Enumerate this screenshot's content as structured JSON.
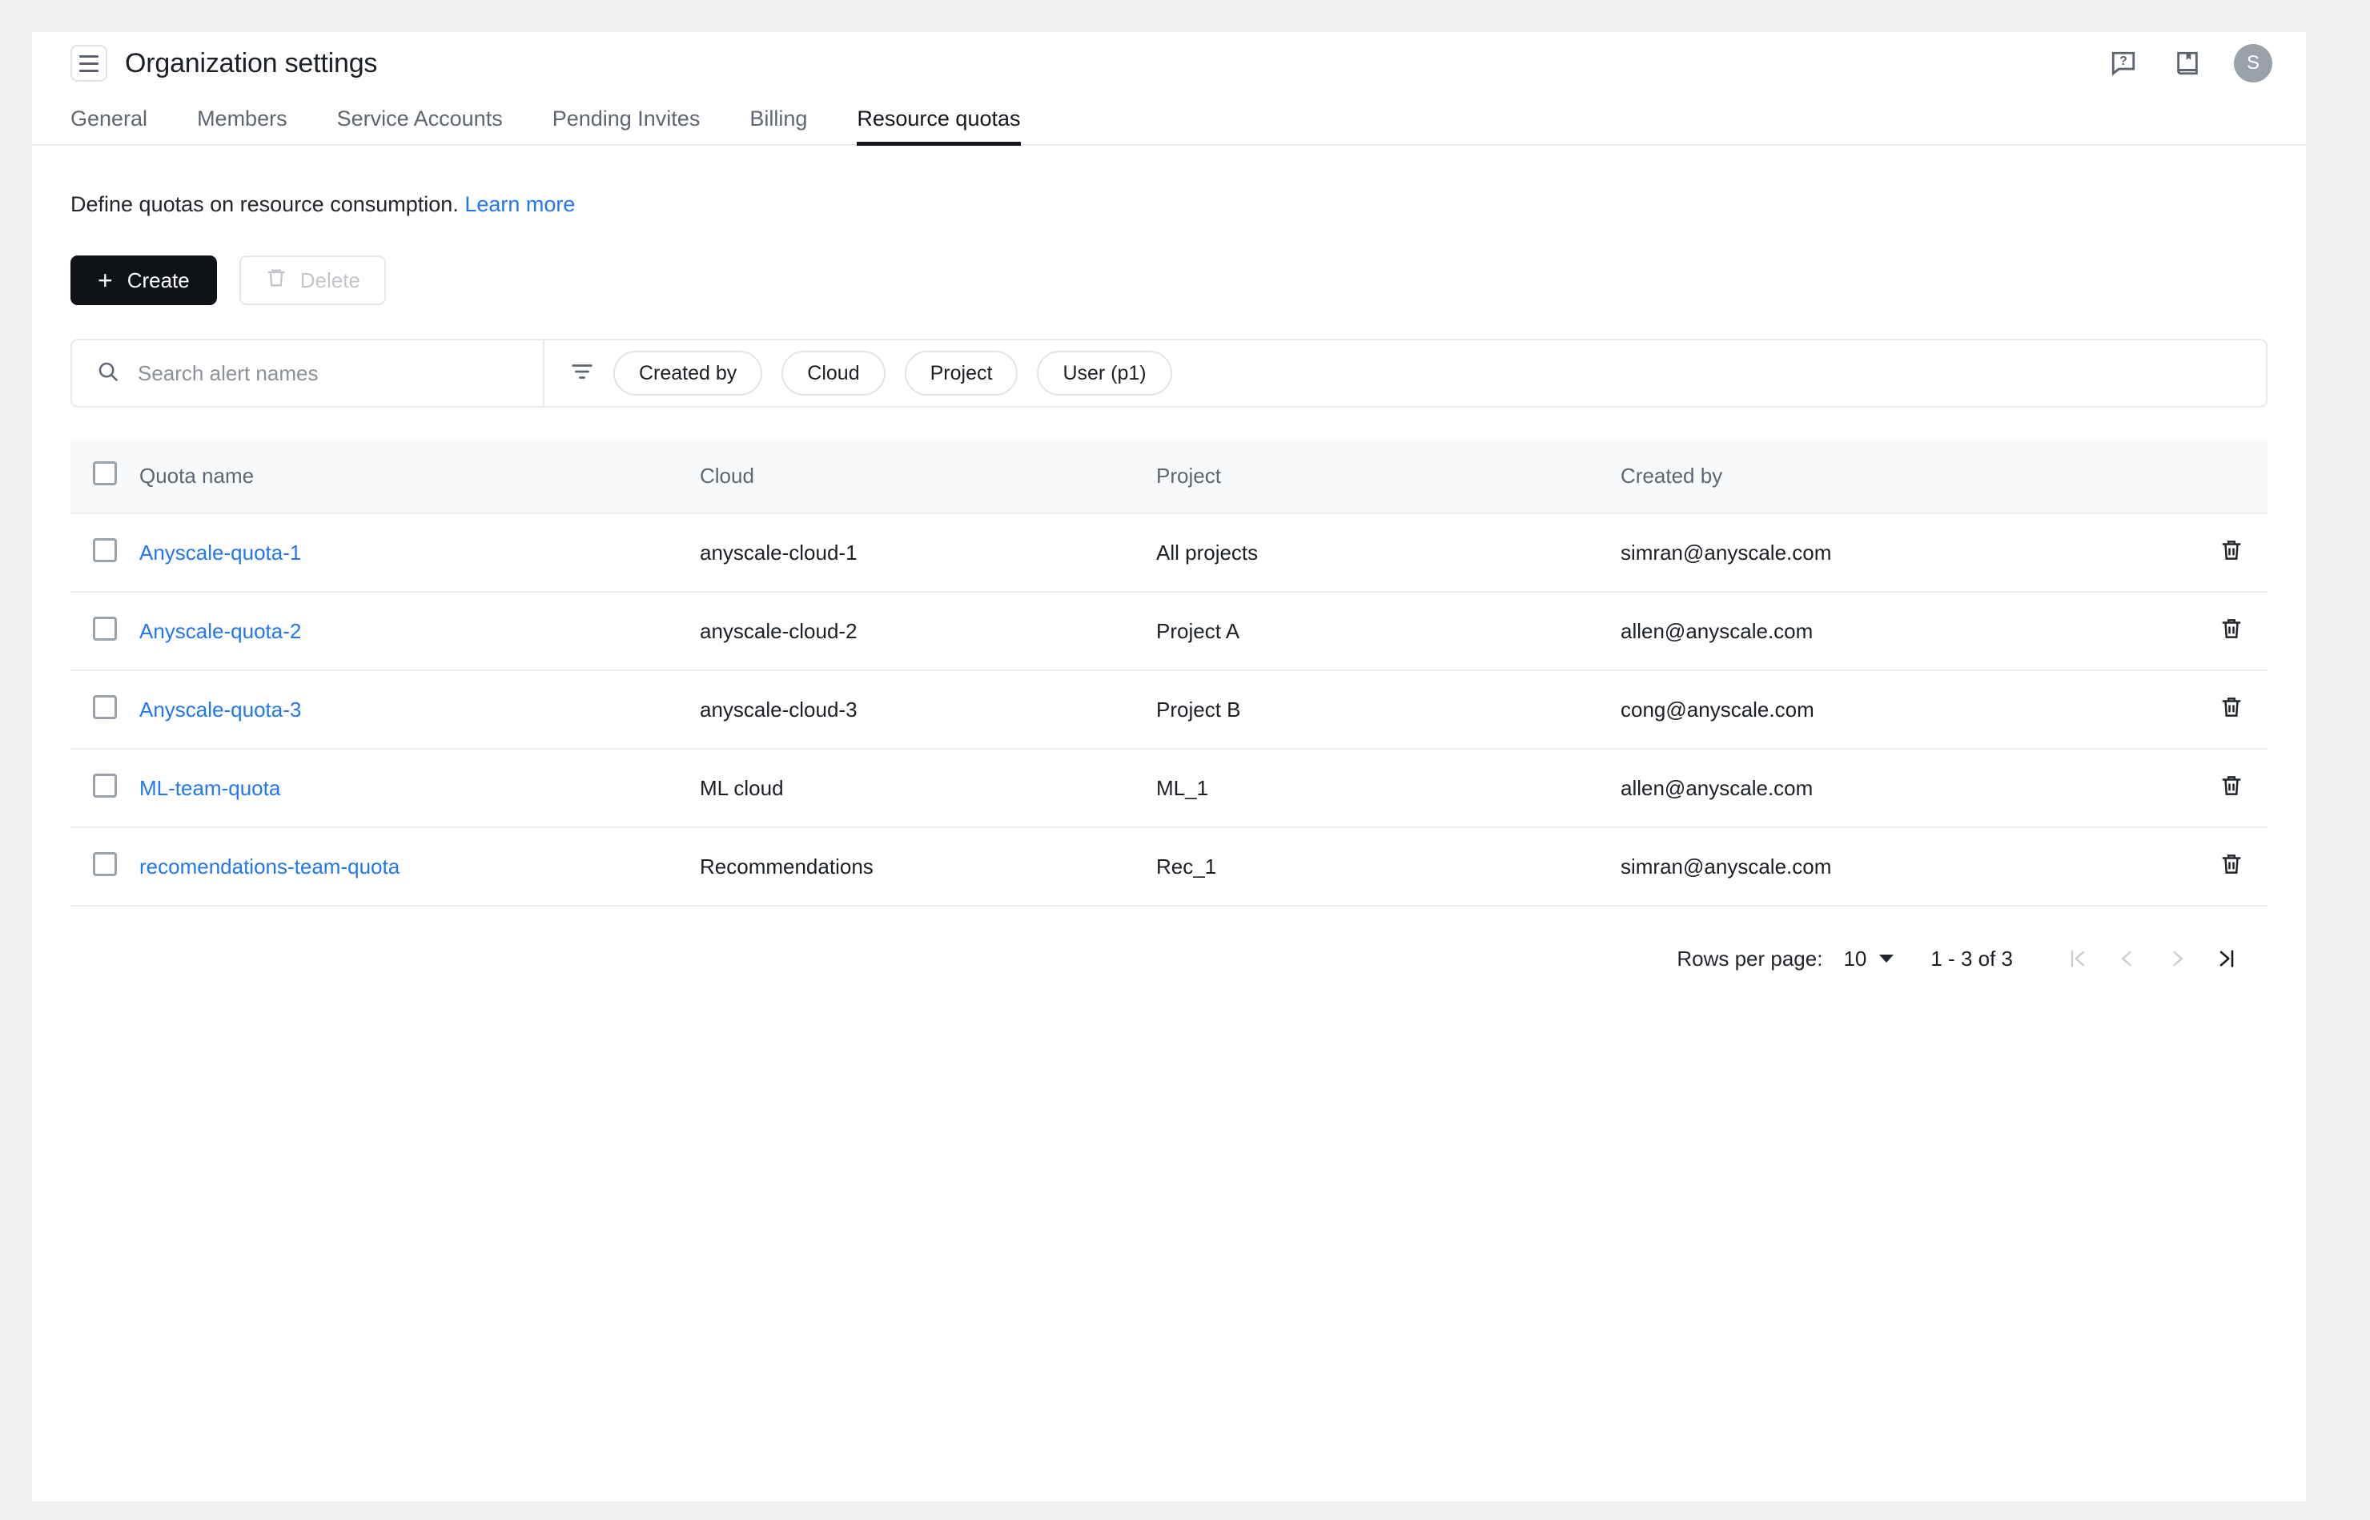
{
  "header": {
    "title": "Organization settings",
    "menu_icon": "hamburger-icon",
    "help_icon": "help-chat-icon",
    "docs_icon": "book-bookmark-icon",
    "avatar_initial": "S"
  },
  "tabs": [
    {
      "label": "General",
      "active": false
    },
    {
      "label": "Members",
      "active": false
    },
    {
      "label": "Service Accounts",
      "active": false
    },
    {
      "label": "Pending Invites",
      "active": false
    },
    {
      "label": "Billing",
      "active": false
    },
    {
      "label": "Resource quotas",
      "active": true
    }
  ],
  "description": {
    "text": "Define quotas on resource consumption.",
    "link_label": "Learn more"
  },
  "actions": {
    "create_label": "Create",
    "create_icon": "plus-icon",
    "delete_label": "Delete",
    "delete_icon": "trash-icon",
    "delete_disabled": true
  },
  "filters": {
    "search_placeholder": "Search alert names",
    "search_value": "",
    "search_icon": "search-icon",
    "filter_icon": "filter-icon",
    "chips": [
      {
        "label": "Created by"
      },
      {
        "label": "Cloud"
      },
      {
        "label": "Project"
      },
      {
        "label": "User (p1)"
      }
    ]
  },
  "table": {
    "columns": [
      "Quota name",
      "Cloud",
      "Project",
      "Created by"
    ],
    "rows": [
      {
        "name": "Anyscale-quota-1",
        "cloud": "anyscale-cloud-1",
        "project": "All projects",
        "created_by": "simran@anyscale.com"
      },
      {
        "name": "Anyscale-quota-2",
        "cloud": "anyscale-cloud-2",
        "project": "Project A",
        "created_by": "allen@anyscale.com"
      },
      {
        "name": "Anyscale-quota-3",
        "cloud": "anyscale-cloud-3",
        "project": "Project B",
        "created_by": "cong@anyscale.com"
      },
      {
        "name": "ML-team-quota",
        "cloud": "ML cloud",
        "project": "ML_1",
        "created_by": "allen@anyscale.com"
      },
      {
        "name": "recomendations-team-quota",
        "cloud": "Recommendations",
        "project": "Rec_1",
        "created_by": "simran@anyscale.com"
      }
    ]
  },
  "pagination": {
    "rows_per_page_label": "Rows per page:",
    "rows_per_page_value": "10",
    "range_label": "1 - 3  of 3",
    "first_icon": "page-first-icon",
    "prev_icon": "page-prev-icon",
    "next_icon": "page-next-icon",
    "last_icon": "page-last-icon"
  },
  "colors": {
    "accent_link": "#2176f3",
    "primary_button": "#0f1318",
    "page_background": "#eff0f2"
  }
}
